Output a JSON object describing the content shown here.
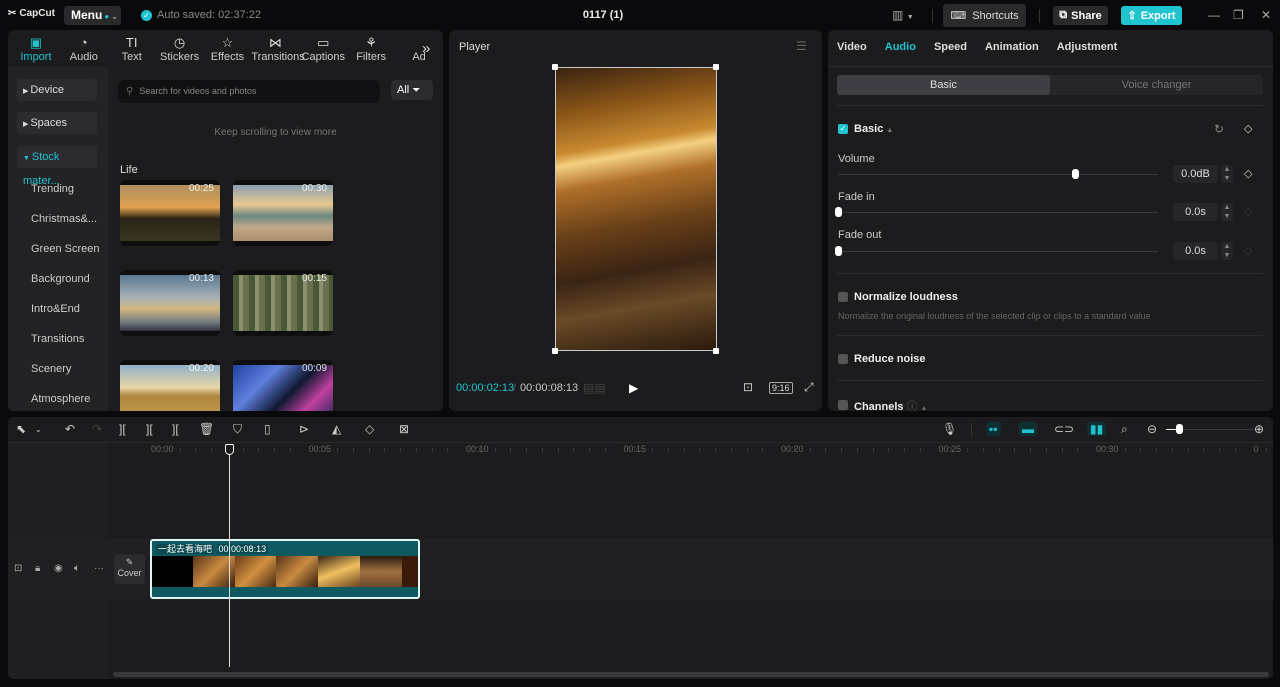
{
  "app": {
    "name": "CapCut",
    "menu_label": "Menu",
    "autosave": "Auto saved: 02:37:22",
    "project_title": "0117 (1)"
  },
  "titlebar": {
    "shortcuts_label": "Shortcuts",
    "share_label": "Share",
    "export_label": "Export",
    "accent": "#20c4cf"
  },
  "media": {
    "tabs": [
      {
        "label": "Import",
        "icon": "import-icon",
        "glyph": "▣",
        "active": true
      },
      {
        "label": "Audio",
        "icon": "audio-icon",
        "glyph": "◔"
      },
      {
        "label": "Text",
        "icon": "text-icon",
        "glyph": "TI"
      },
      {
        "label": "Stickers",
        "icon": "sticker-icon",
        "glyph": "◷"
      },
      {
        "label": "Effects",
        "icon": "effects-icon",
        "glyph": "☆"
      },
      {
        "label": "Transitions",
        "icon": "transitions-icon",
        "glyph": "⋈"
      },
      {
        "label": "Captions",
        "icon": "captions-icon",
        "glyph": "▭"
      },
      {
        "label": "Filters",
        "icon": "filters-icon",
        "glyph": "⚘"
      },
      {
        "label": "Ad",
        "icon": "adjust-icon",
        "glyph": ""
      }
    ],
    "categories": [
      {
        "label": "Device",
        "expanded": false
      },
      {
        "label": "Spaces",
        "expanded": false
      },
      {
        "label": "Stock mater...",
        "expanded": true
      }
    ],
    "subcategories": [
      "Trending",
      "Christmas&...",
      "Green Screen",
      "Background",
      "Intro&End",
      "Transitions",
      "Scenery",
      "Atmosphere"
    ],
    "search_placeholder": "Search for videos and photos",
    "filter_label": "All",
    "keep_scrolling": "Keep scrolling to view more",
    "section_title": "Life",
    "thumbnails": [
      {
        "duration": "00:25",
        "desc": "children running at sunset"
      },
      {
        "duration": "00:30",
        "desc": "woman on beach"
      },
      {
        "duration": "00:13",
        "desc": "airplane taking off"
      },
      {
        "duration": "00:15",
        "desc": "woman in forest"
      },
      {
        "duration": "00:20",
        "desc": "woman in wheat field"
      },
      {
        "duration": "00:09",
        "desc": "city night street"
      }
    ]
  },
  "player": {
    "title": "Player",
    "current_time": "00:00:02:13",
    "total_time": "00:00:08:13",
    "ratio": "9:16"
  },
  "properties": {
    "tabs": [
      "Video",
      "Audio",
      "Speed",
      "Animation",
      "Adjustment"
    ],
    "active_tab": "Audio",
    "subtabs": [
      "Basic",
      "Voice changer"
    ],
    "basic": {
      "title": "Basic",
      "enabled": true,
      "volume": {
        "label": "Volume",
        "value": "0.0dB",
        "slider_fraction": 0.74
      },
      "fade_in": {
        "label": "Fade in",
        "value": "0.0s",
        "slider_fraction": 0
      },
      "fade_out": {
        "label": "Fade out",
        "value": "0.0s",
        "slider_fraction": 0
      }
    },
    "normalize": {
      "title": "Normalize loudness",
      "enabled": false,
      "desc": "Normalize the original loudness of the selected clip or clips to a standard value"
    },
    "reduce_noise": {
      "title": "Reduce noise",
      "enabled": false
    },
    "channels": {
      "title": "Channels",
      "enabled": false
    }
  },
  "timeline": {
    "ruler_labels": [
      "00:00",
      "00:05",
      "00:10",
      "00:15",
      "00:20",
      "00:25",
      "00:30",
      "0"
    ],
    "clip": {
      "title": "一起去看海吧",
      "duration": "00:00:08:13"
    },
    "cover_label": "Cover"
  }
}
